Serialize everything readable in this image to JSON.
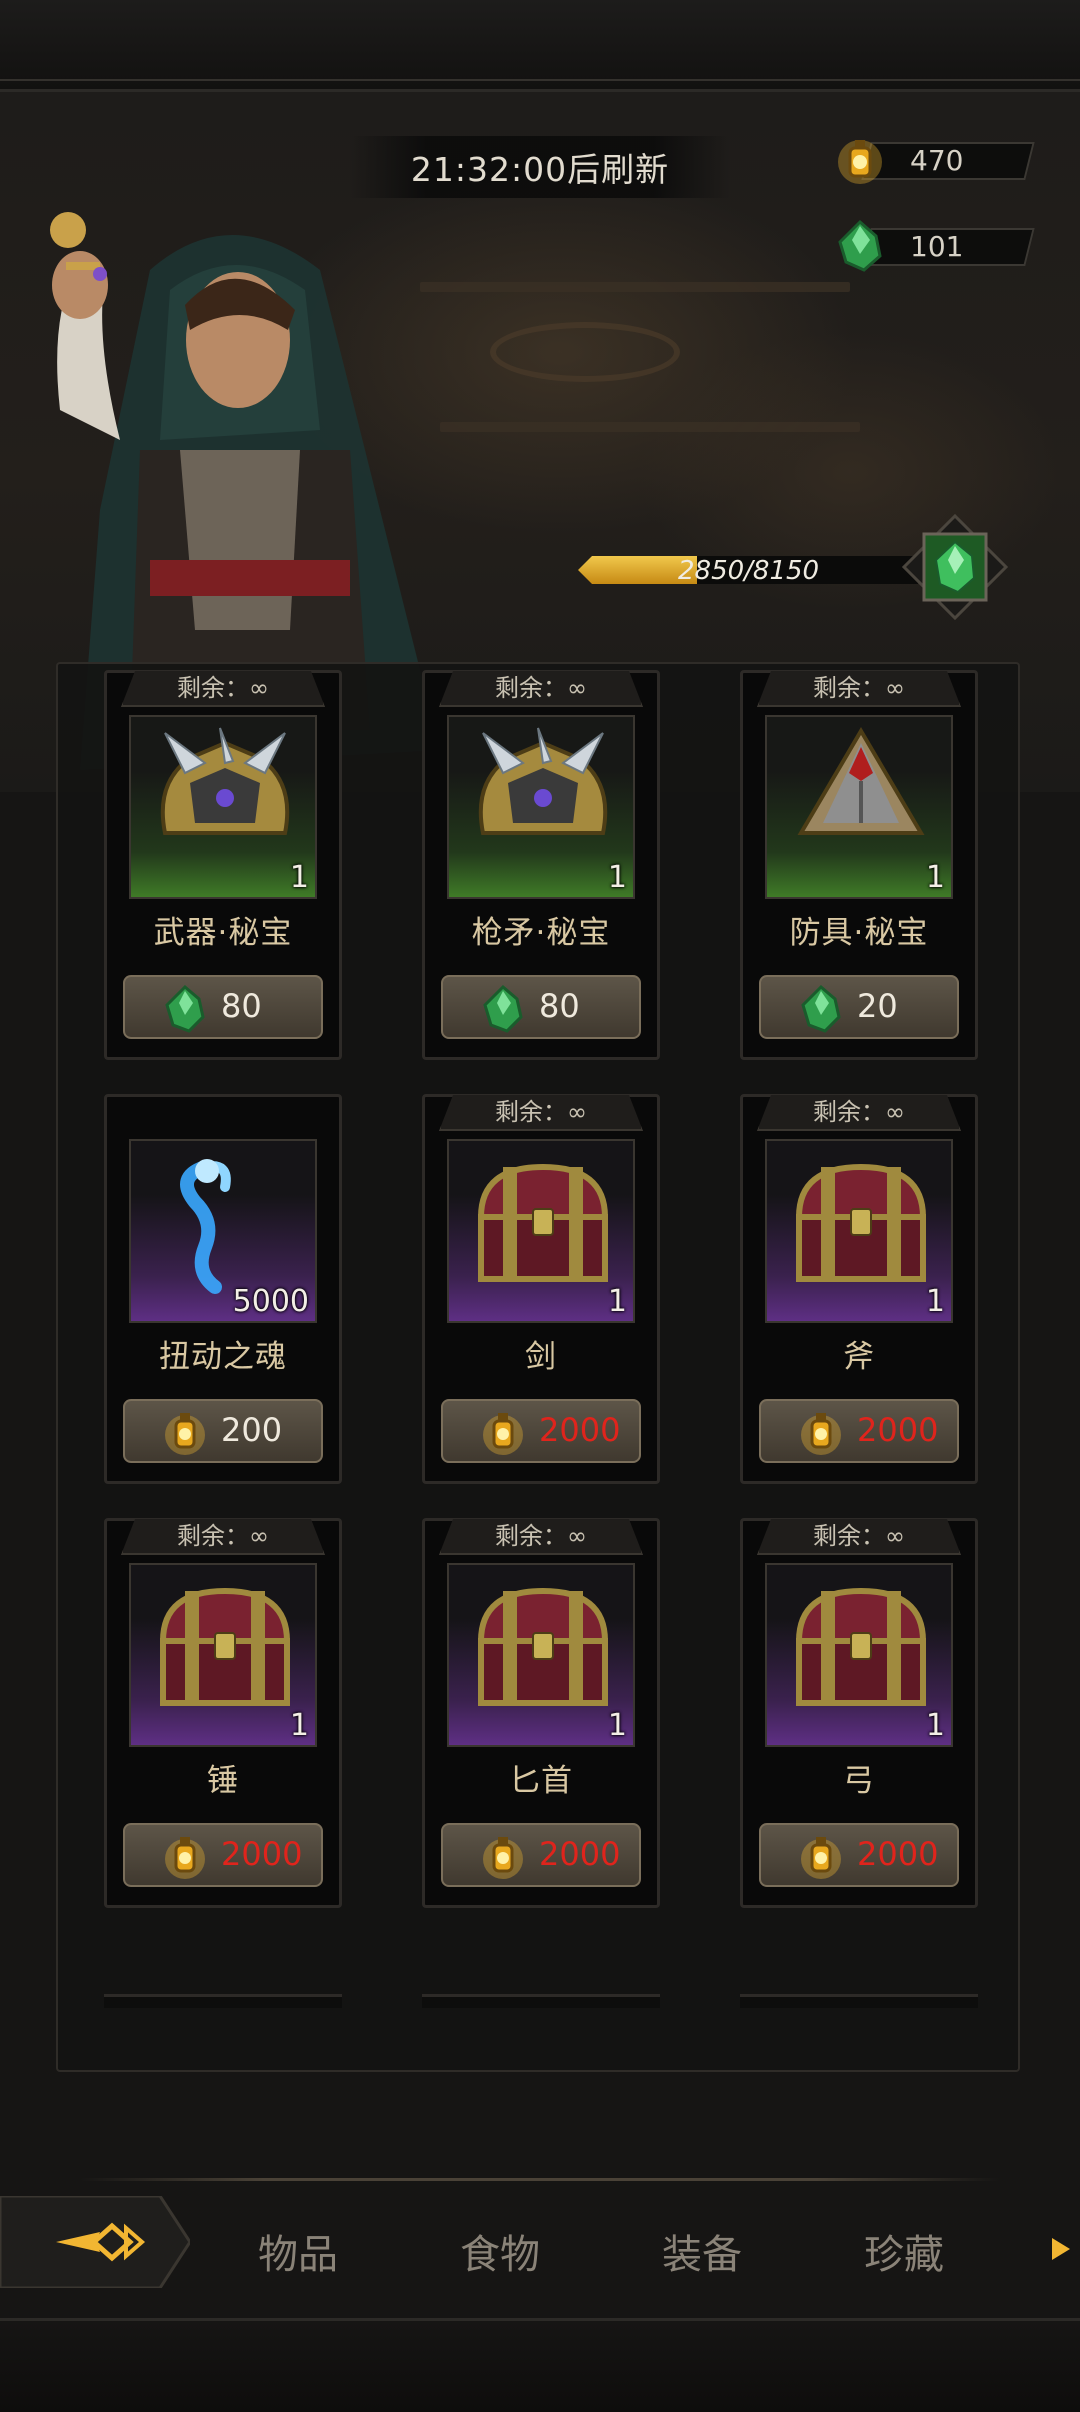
{
  "header": {
    "refresh_timer": "21:32:00后刷新"
  },
  "currencies": [
    {
      "name": "gold-lantern",
      "value": "470",
      "color": "#f2b632"
    },
    {
      "name": "green-crystal",
      "value": "101",
      "color": "#3fbf5e"
    }
  ],
  "progress": {
    "text": "2850/8150",
    "current": 2850,
    "max": 8150
  },
  "shop": {
    "items": [
      {
        "remain": "剩余：∞",
        "name": "武器·秘宝",
        "qty": "1",
        "rarity": "green",
        "icon": "spiked-helmet-icon",
        "price": "80",
        "currency": "green-crystal-icon",
        "affordable": true
      },
      {
        "remain": "剩余：∞",
        "name": "枪矛·秘宝",
        "qty": "1",
        "rarity": "green",
        "icon": "spiked-helmet-icon",
        "price": "80",
        "currency": "green-crystal-icon",
        "affordable": true
      },
      {
        "remain": "剩余：∞",
        "name": "防具·秘宝",
        "qty": "1",
        "rarity": "green",
        "icon": "armor-helmet-icon",
        "price": "20",
        "currency": "green-crystal-icon",
        "affordable": true
      },
      {
        "remain": "",
        "name": "扭动之魂",
        "qty": "5000",
        "rarity": "purple",
        "icon": "blue-soul-icon",
        "price": "200",
        "currency": "gold-lantern-icon",
        "affordable": true
      },
      {
        "remain": "剩余：∞",
        "name": "剑",
        "qty": "1",
        "rarity": "purple",
        "icon": "treasure-chest-icon",
        "price": "2000",
        "currency": "gold-lantern-icon",
        "affordable": false
      },
      {
        "remain": "剩余：∞",
        "name": "斧",
        "qty": "1",
        "rarity": "purple",
        "icon": "treasure-chest-icon",
        "price": "2000",
        "currency": "gold-lantern-icon",
        "affordable": false
      },
      {
        "remain": "剩余：∞",
        "name": "锤",
        "qty": "1",
        "rarity": "purple",
        "icon": "treasure-chest-icon",
        "price": "2000",
        "currency": "gold-lantern-icon",
        "affordable": false
      },
      {
        "remain": "剩余：∞",
        "name": "匕首",
        "qty": "1",
        "rarity": "purple",
        "icon": "treasure-chest-icon",
        "price": "2000",
        "currency": "gold-lantern-icon",
        "affordable": false
      },
      {
        "remain": "剩余：∞",
        "name": "弓",
        "qty": "1",
        "rarity": "purple",
        "icon": "treasure-chest-icon",
        "price": "2000",
        "currency": "gold-lantern-icon",
        "affordable": false
      }
    ]
  },
  "tabs": [
    {
      "label": "物品"
    },
    {
      "label": "食物"
    },
    {
      "label": "装备"
    },
    {
      "label": "珍藏"
    }
  ],
  "colors": {
    "price_unaffordable": "#e0241c",
    "accent_gold": "#f1c84c"
  }
}
